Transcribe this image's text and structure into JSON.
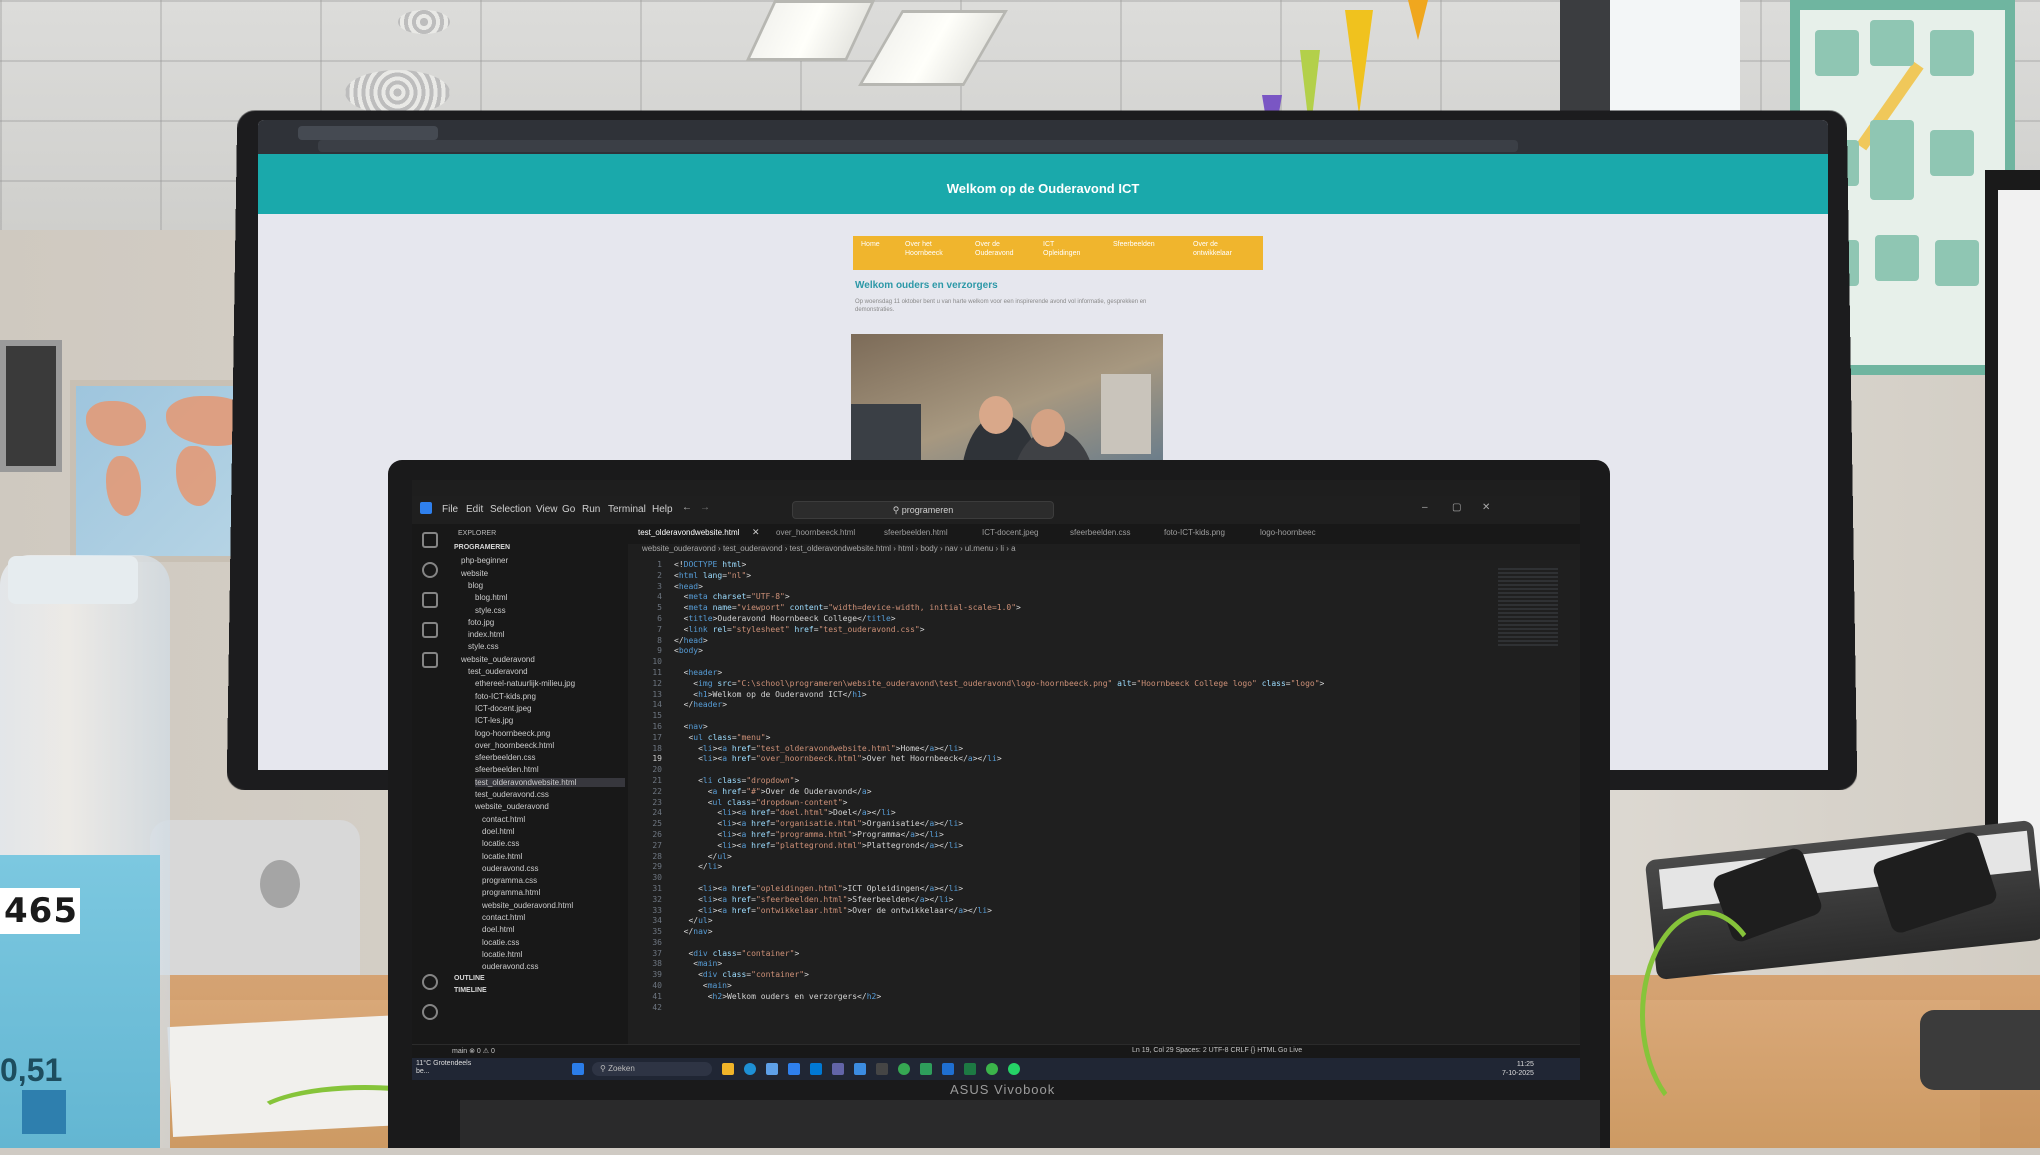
{
  "monitor_page": {
    "header_title": "Welkom op de Ouderavond ICT",
    "nav": [
      "Home",
      "Over het Hoornbeeck",
      "Over de Ouderavond",
      "ICT Opleidingen",
      "Sfeerbeelden",
      "Over de ontwikkelaar"
    ],
    "section_heading": "Welkom ouders en verzorgers",
    "intro_text": "Op woensdag 11 oktober bent u van harte welkom voor een inspirerende avond vol informatie, gesprekken en demonstraties."
  },
  "vscode": {
    "menu": [
      "File",
      "Edit",
      "Selection",
      "View",
      "Go",
      "Run",
      "Terminal",
      "Help"
    ],
    "search_placeholder": "programeren",
    "explorer_title": "EXPLORER",
    "tabs": [
      "test_olderavondwebsite.html",
      "over_hoornbeeck.html",
      "sfeerbeelden.html",
      "ICT-docent.jpeg",
      "sfeerbeelden.css",
      "foto-ICT-kids.png",
      "logo-hoornbeec"
    ],
    "breadcrumb": "website_ouderavond  ›  test_ouderavond  ›  test_olderavondwebsite.html  ›  html  ›  body  ›  nav  ›  ul.menu  ›  li  ›  a",
    "tree": [
      "PROGRAMEREN",
      "php-beginner",
      "website",
      "blog",
      "blog.html",
      "style.css",
      "foto.jpg",
      "index.html",
      "style.css",
      "website_ouderavond",
      "test_ouderavond",
      "ethereel-natuurlijk-milieu.jpg",
      "foto-ICT-kids.png",
      "ICT-docent.jpeg",
      "ICT-les.jpg",
      "logo-hoornbeeck.png",
      "over_hoornbeeck.html",
      "sfeerbeelden.css",
      "sfeerbeelden.html",
      "test_olderavondwebsite.html",
      "test_ouderavond.css",
      "website_ouderavond",
      "contact.html",
      "doel.html",
      "locatie.css",
      "locatie.html",
      "ouderavond.css",
      "programma.css",
      "programma.html",
      "website_ouderavond.html",
      "contact.html",
      "doel.html",
      "locatie.css",
      "locatie.html",
      "ouderavond.css",
      "OUTLINE",
      "TIMELINE"
    ],
    "status_right": "Ln 19, Col 29   Spaces: 2   UTF-8   CRLF   {}  HTML   Go Live",
    "status_left": "main  ⊗ 0 ⚠ 0",
    "taskbar_search": "Zoeken",
    "weather": "11°C Grotendeels be...",
    "clock_time": "11:25",
    "clock_date": "7-10-2025"
  },
  "laptop_brand": "ASUS Vivobook",
  "bottle": {
    "number": "465",
    "volume": "0,51"
  }
}
